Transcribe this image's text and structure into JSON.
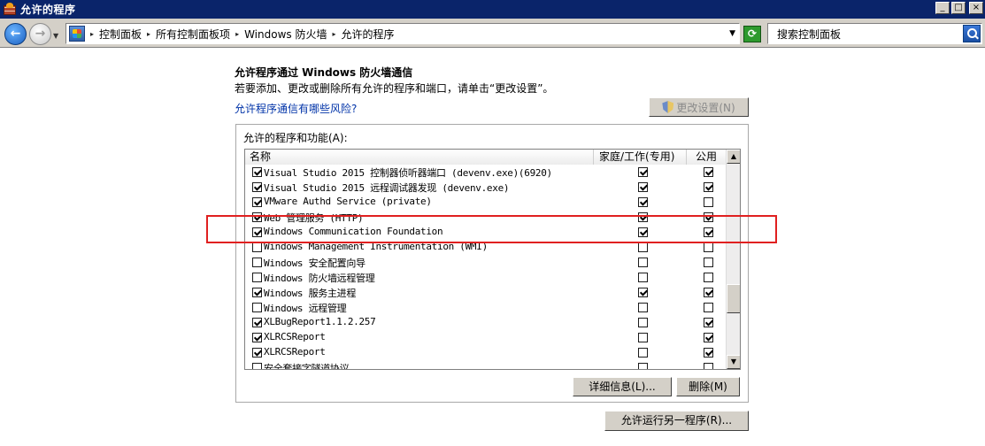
{
  "window": {
    "title": "允许的程序",
    "buttons": {
      "minimize": "_",
      "maximize": "□",
      "close": "×"
    }
  },
  "addressbar": {
    "breadcrumbs": [
      "控制面板",
      "所有控制面板项",
      "Windows 防火墙",
      "允许的程序"
    ],
    "search_placeholder": "搜索控制面板"
  },
  "content": {
    "heading": "允许程序通过 Windows 防火墙通信",
    "description": "若要添加、更改或删除所有允许的程序和端口，请单击“更改设置”。",
    "risk_link": "允许程序通信有哪些风险?",
    "change_settings_button": "更改设置(N)",
    "group_label": "允许的程序和功能(A):",
    "columns": {
      "name": "名称",
      "home": "家庭/工作(专用)",
      "public": "公用"
    },
    "programs": [
      {
        "name": "Visual Studio 2015 控制器侦听器端口 (devenv.exe)(6920)",
        "enabled": true,
        "home": true,
        "public": true
      },
      {
        "name": "Visual Studio 2015 远程调试器发现 (devenv.exe)",
        "enabled": true,
        "home": true,
        "public": true
      },
      {
        "name": "VMware Authd Service (private)",
        "enabled": true,
        "home": true,
        "public": false
      },
      {
        "name": "Web 管理服务 (HTTP)",
        "enabled": true,
        "home": true,
        "public": true
      },
      {
        "name": "Windows Communication Foundation",
        "enabled": true,
        "home": true,
        "public": true
      },
      {
        "name": "Windows Management Instrumentation (WMI)",
        "enabled": false,
        "home": false,
        "public": false
      },
      {
        "name": "Windows 安全配置向导",
        "enabled": false,
        "home": false,
        "public": false
      },
      {
        "name": "Windows 防火墙远程管理",
        "enabled": false,
        "home": false,
        "public": false
      },
      {
        "name": "Windows 服务主进程",
        "enabled": true,
        "home": true,
        "public": true
      },
      {
        "name": "Windows 远程管理",
        "enabled": false,
        "home": false,
        "public": false
      },
      {
        "name": "XLBugReport1.1.2.257",
        "enabled": true,
        "home": false,
        "public": true
      },
      {
        "name": "XLRCSReport",
        "enabled": true,
        "home": false,
        "public": true
      },
      {
        "name": "XLRCSReport",
        "enabled": true,
        "home": false,
        "public": true
      },
      {
        "name": "安全套接字隧道协议",
        "enabled": false,
        "home": false,
        "public": false
      }
    ],
    "details_button": "详细信息(L)...",
    "delete_button": "删除(M)",
    "allow_other_button": "允许运行另一程序(R)..."
  },
  "colors": {
    "highlight": "#e02020",
    "link": "#0033a8",
    "titlebar": "#0a246a"
  }
}
